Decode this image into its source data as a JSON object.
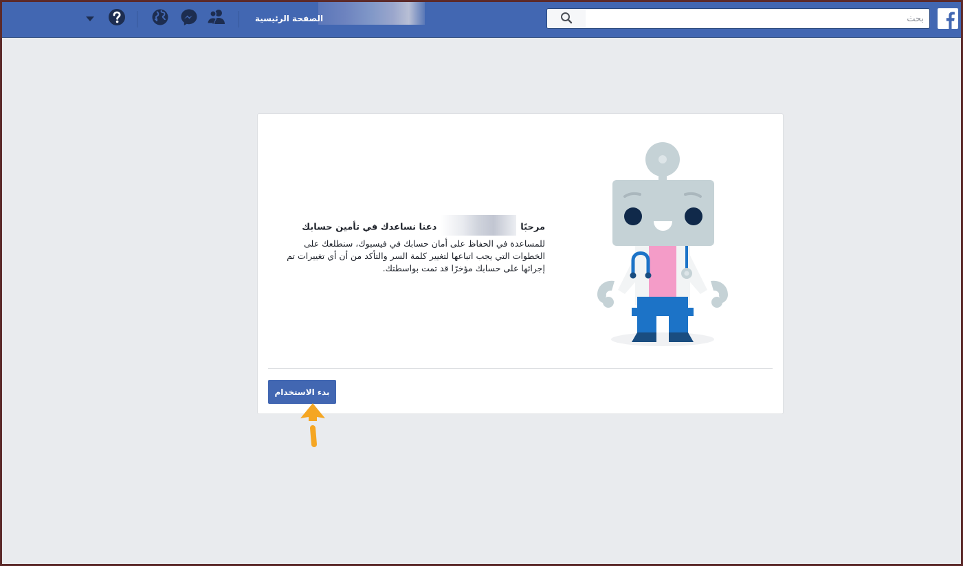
{
  "topbar": {
    "search": {
      "placeholder": "بحث",
      "value": ""
    },
    "home_label": "الصفحة الرئيسية",
    "icons": [
      "facebook-logo",
      "search-icon",
      "friends-icon",
      "messenger-icon",
      "globe-icon",
      "help-icon",
      "caret-down-icon"
    ]
  },
  "card": {
    "welcome_prefix": "مرحبًا",
    "welcome_suffix": "دعنا نساعدك في تأمين حسابك",
    "intro_text": "للمساعدة في الحفاظ على أمان حسابك في فيسبوك، سنطلعك على الخطوات التي يجب اتباعها لتغيير كلمة السر والتأكد من أن أي تغييرات تم إجرائها على حسابك مؤخرًا قد تمت بواسطتك.",
    "start_button": "بدء الاستخدام"
  },
  "colors": {
    "brand": "#4267b2",
    "background": "#e9ebee",
    "annotation_arrow": "#f5a623"
  }
}
